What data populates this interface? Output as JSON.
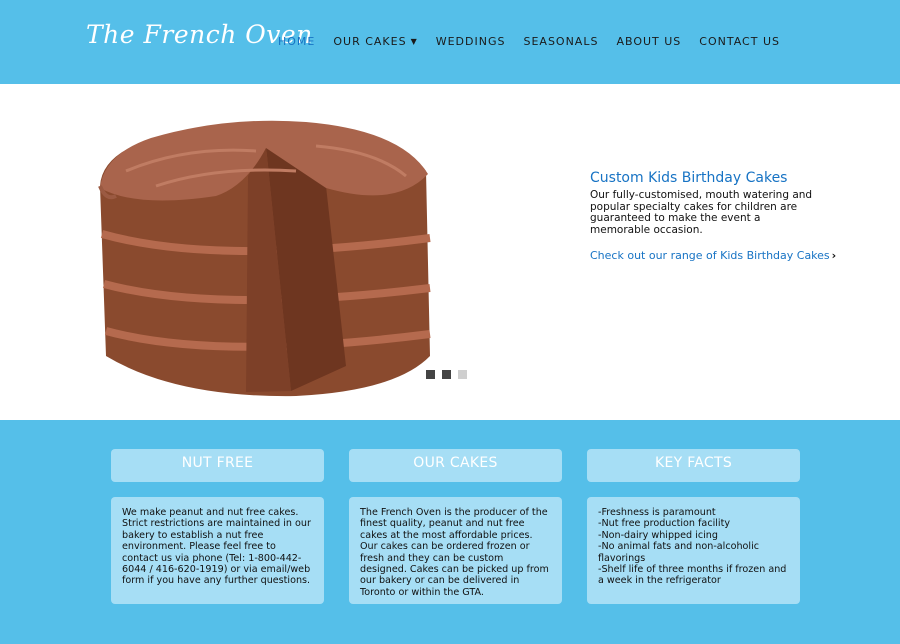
{
  "header": {
    "logo": "The French Oven",
    "nav": [
      {
        "label": "HOME",
        "active": true
      },
      {
        "label": "OUR CAKES",
        "has_dropdown": true
      },
      {
        "label": "WEDDINGS"
      },
      {
        "label": "SEASONALS"
      },
      {
        "label": "ABOUT US"
      },
      {
        "label": "CONTACT US"
      }
    ]
  },
  "hero": {
    "title": "Custom Kids Birthday Cakes",
    "description": "Our fully-customised, mouth watering and popular specialty cakes for children are guaranteed to make the event a memorable occasion.",
    "link": "Check out our range of Kids Birthday Cakes",
    "slide_dots": 3,
    "active_slide": 1
  },
  "columns": [
    {
      "heading": "NUT FREE",
      "body": "We make peanut and nut free cakes. Strict restrictions are maintained in our bakery to establish a nut free environment. Please feel free to contact us via phone (Tel: 1-800-442-6044 / 416-620-1919) or via email/web form if you have any further questions."
    },
    {
      "heading": "OUR CAKES",
      "body": "The French Oven is the producer of the finest quality, peanut and nut free cakes at the most affordable prices. Our cakes can be ordered frozen or fresh and they can be custom designed. Cakes can be picked up from our bakery or can be delivered in Toronto or within the GTA."
    },
    {
      "heading": "KEY FACTS",
      "facts": [
        "-Freshness is paramount",
        "-Nut free production facility",
        "-Non-dairy whipped icing",
        "-No animal fats and non-alcoholic flavorings",
        "-Shelf life of three months if frozen and a week in the refrigerator"
      ]
    }
  ],
  "colors": {
    "header_bg": "#55bfe9",
    "accent_blue": "#1773c4",
    "panel_bg": "#a6def5"
  }
}
